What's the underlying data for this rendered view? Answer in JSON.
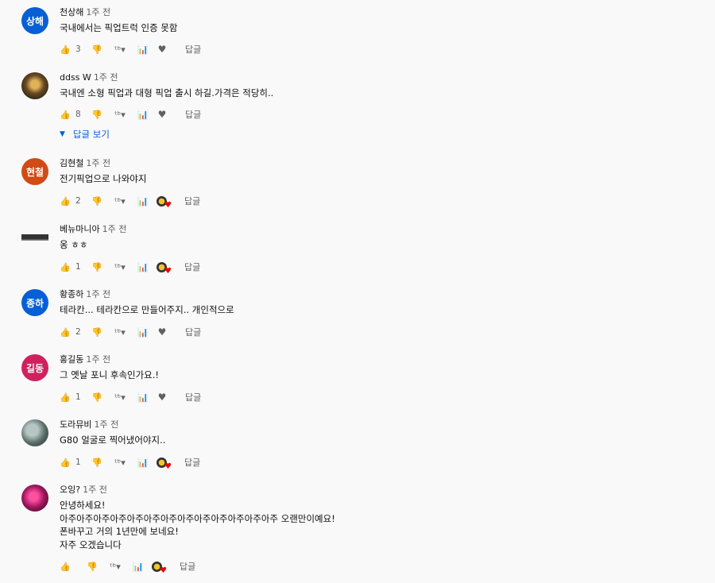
{
  "comments": [
    {
      "author": "천상해",
      "time": "1주 전",
      "text": "국내에서는 픽업트럭 인증 못함",
      "avatar_text": "상해",
      "avatar_color": "#065fd4",
      "likes": "3",
      "creator_heart": false,
      "reply": "답글"
    },
    {
      "author": "ddss W",
      "time": "1주 전",
      "text": "국내엔 소형 픽업과 대형 픽업 출시 하길.가격은 적당히..",
      "avatar_text": "",
      "avatar_color": "",
      "likes": "8",
      "creator_heart": false,
      "reply": "답글",
      "show_replies": "답글 보기"
    },
    {
      "author": "김현철",
      "time": "1주 전",
      "text": "전기픽업으로 나와야지",
      "avatar_text": "현철",
      "avatar_color": "#d14b14",
      "likes": "2",
      "creator_heart": true,
      "reply": "답글"
    },
    {
      "author": "베뉴마니아",
      "time": "1주 전",
      "text": "옹 ㅎㅎ",
      "avatar_text": "",
      "avatar_color": "",
      "likes": "1",
      "creator_heart": true,
      "reply": "답글"
    },
    {
      "author": "황종하",
      "time": "1주 전",
      "text": "테라칸... 테라칸으로 만들어주지.. 개인적으로",
      "avatar_text": "종하",
      "avatar_color": "#065fd4",
      "likes": "2",
      "creator_heart": false,
      "reply": "답글"
    },
    {
      "author": "홍길동",
      "time": "1주 전",
      "text": "그 옛날 포니 후속인가요.!",
      "avatar_text": "길동",
      "avatar_color": "#d0215f",
      "likes": "1",
      "creator_heart": false,
      "reply": "답글"
    },
    {
      "author": "도라뮤비",
      "time": "1주 전",
      "text": "G80  얼굴로 찍어냈어야지..",
      "avatar_text": "",
      "avatar_color": "",
      "likes": "1",
      "creator_heart": true,
      "reply": "답글"
    },
    {
      "author": "오잉?",
      "time": "1주 전",
      "text": "안녕하세요!\n아주아주아주아주아주아주아주아주아주아주아주아주아주 오랜만이예요!\n폰바꾸고 거의 1년만에 보네요!\n자주 오겠습니다",
      "avatar_text": "",
      "avatar_color": "",
      "likes": "",
      "creator_heart": true,
      "reply": "답글"
    }
  ],
  "icons": {
    "like": "thumbs-up-icon",
    "dislike": "thumbs-down-icon",
    "heart": "heart-icon"
  }
}
